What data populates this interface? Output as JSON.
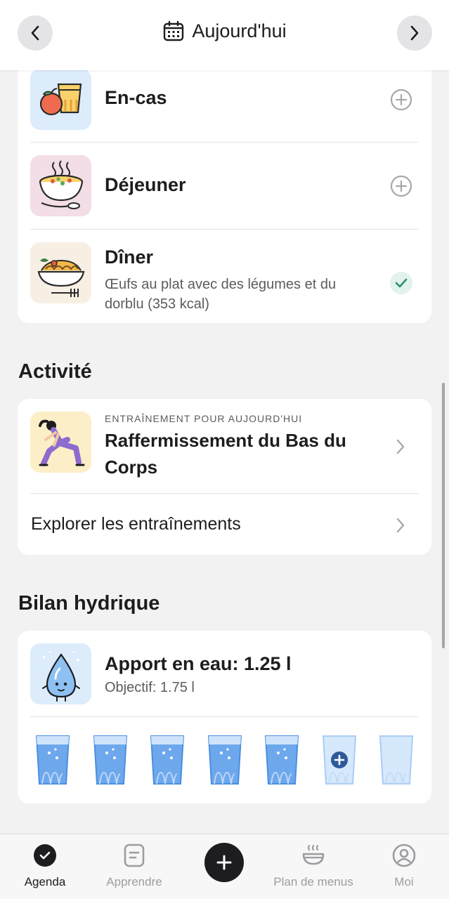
{
  "header": {
    "title": "Aujourd'hui",
    "prev_icon": "chevron-left-icon",
    "next_icon": "chevron-right-icon",
    "calendar_icon": "calendar-icon"
  },
  "meals": [
    {
      "title": "En-cas",
      "description": "",
      "state": "add",
      "icon": "snack-illustration",
      "tile_color": "#dcecfb"
    },
    {
      "title": "Déjeuner",
      "description": "",
      "state": "add",
      "icon": "soup-illustration",
      "tile_color": "#f3dde6"
    },
    {
      "title": "Dîner",
      "description": "Œufs au plat avec des légumes et du dorblu (353 kcal)",
      "state": "done",
      "icon": "pasta-illustration",
      "tile_color": "#f8efe4"
    }
  ],
  "activity": {
    "section_title": "Activité",
    "eyebrow": "ENTRAÎNEMENT POUR AUJOURD'HUI",
    "workout_title": "Raffermissement du Bas du Corps",
    "explore_label": "Explorer les entraînements",
    "tile_color": "#fcefc7"
  },
  "water": {
    "section_title": "Bilan hydrique",
    "intake_label": "Apport en eau: 1.25 l",
    "goal_label": "Objectif: 1.75 l",
    "glasses_total": 7,
    "glasses_filled": 5,
    "tile_color": "#dcecfb"
  },
  "tabbar": {
    "items": [
      {
        "label": "Agenda",
        "icon": "check-circle-icon",
        "active": true
      },
      {
        "label": "Apprendre",
        "icon": "book-icon",
        "active": false
      },
      {
        "label": "",
        "icon": "plus-icon",
        "active": false
      },
      {
        "label": "Plan de menus",
        "icon": "bowl-icon",
        "active": false
      },
      {
        "label": "Moi",
        "icon": "profile-icon",
        "active": false
      }
    ]
  },
  "colors": {
    "accent_dark": "#1d1d1f",
    "check_green": "#2f8f6a",
    "water_blue": "#6ea8ec"
  }
}
